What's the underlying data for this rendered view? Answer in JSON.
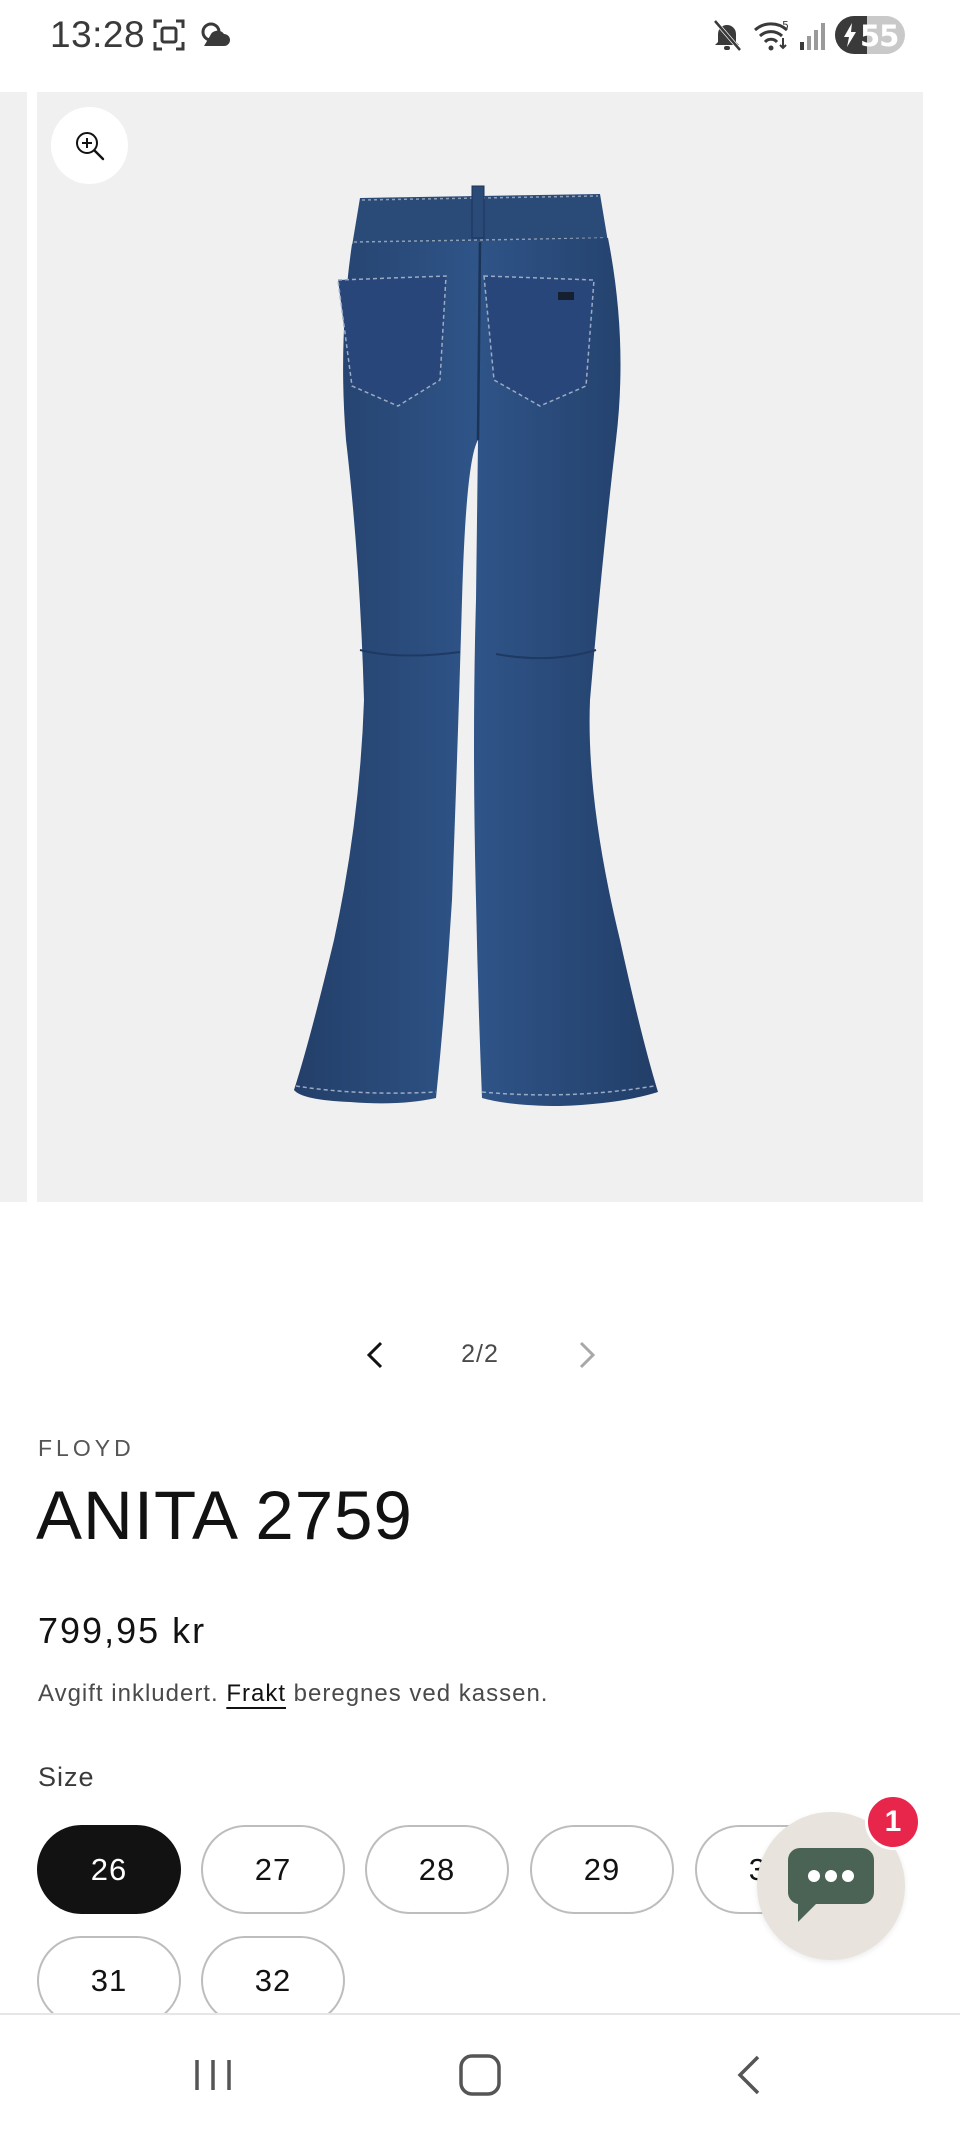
{
  "status_bar": {
    "time": "13:28",
    "battery": "55",
    "icons": [
      "screenshot-icon",
      "cloud-icon",
      "mute-icon",
      "wifi-icon",
      "signal-icon",
      "battery-icon"
    ]
  },
  "gallery": {
    "counter": "2/2",
    "current": 2,
    "total": 2,
    "image_alt": "jeans-back-view",
    "colors": {
      "slide_bg": "#f0f0f0",
      "denim": "#2c4d7c"
    }
  },
  "product": {
    "vendor": "FLOYD",
    "title": "ANITA 2759",
    "price": "799,95 kr",
    "tax_note_before": "Avgift inkludert. ",
    "tax_note_link": "Frakt",
    "tax_note_after": " beregnes ved kassen."
  },
  "sizes": {
    "label": "Size",
    "options": [
      "26",
      "27",
      "28",
      "29",
      "30",
      "31",
      "32"
    ],
    "selected": "26"
  },
  "chat": {
    "badge": "1",
    "colors": {
      "bubble": "#e8e3dd",
      "icon": "#4a6354",
      "badge": "#e8254b"
    }
  },
  "nav": {
    "icons": [
      "recent-apps-icon",
      "home-icon",
      "back-icon"
    ]
  }
}
